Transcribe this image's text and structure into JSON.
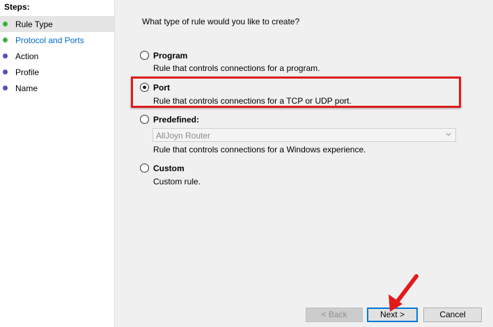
{
  "sidebar": {
    "title": "Steps:",
    "items": [
      {
        "label": "Rule Type",
        "dot_color": "#3cb043"
      },
      {
        "label": "Protocol and Ports",
        "dot_color": "#3cb043"
      },
      {
        "label": "Action",
        "dot_color": "#4d4dbf"
      },
      {
        "label": "Profile",
        "dot_color": "#4d4dbf"
      },
      {
        "label": "Name",
        "dot_color": "#4d4dbf"
      }
    ]
  },
  "main": {
    "question": "What type of rule would you like to create?",
    "options": [
      {
        "title": "Program",
        "desc": "Rule that controls connections for a program.",
        "checked": false
      },
      {
        "title": "Port",
        "desc": "Rule that controls connections for a TCP or UDP port.",
        "checked": true
      },
      {
        "title": "Predefined:",
        "desc": "Rule that controls connections for a Windows experience.",
        "checked": false
      },
      {
        "title": "Custom",
        "desc": "Custom rule.",
        "checked": false
      }
    ],
    "predefined_select_value": "AllJoyn Router"
  },
  "buttons": {
    "back": "< Back",
    "next": "Next >",
    "cancel": "Cancel"
  },
  "colors": {
    "highlight": "#dd1c1c",
    "link": "#0066cc",
    "accent": "#0078d7"
  }
}
